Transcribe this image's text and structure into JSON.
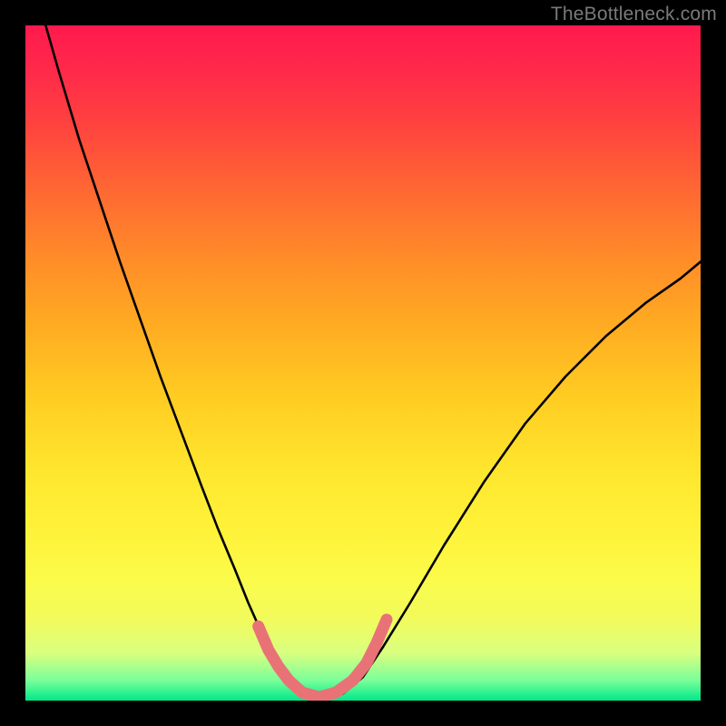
{
  "watermark": "TheBottleneck.com",
  "colors": {
    "background": "#000000",
    "curve": "#000000",
    "highlight": "#e97277",
    "gradient_top": "#ff1a4d",
    "gradient_bottom": "#00e88a"
  },
  "chart_data": {
    "type": "line",
    "title": "",
    "xlabel": "",
    "ylabel": "",
    "xlim": [
      0,
      1
    ],
    "ylim": [
      0,
      1
    ],
    "grid": false,
    "legend": false,
    "annotations": [],
    "series": [
      {
        "name": "left-branch",
        "x": [
          0.03,
          0.05,
          0.08,
          0.11,
          0.14,
          0.17,
          0.2,
          0.23,
          0.26,
          0.285,
          0.31,
          0.33,
          0.35,
          0.37,
          0.385
        ],
        "y": [
          1.0,
          0.93,
          0.83,
          0.74,
          0.65,
          0.565,
          0.48,
          0.4,
          0.32,
          0.255,
          0.195,
          0.145,
          0.1,
          0.06,
          0.035
        ]
      },
      {
        "name": "valley-floor",
        "x": [
          0.385,
          0.41,
          0.44,
          0.47,
          0.5
        ],
        "y": [
          0.035,
          0.01,
          0.0,
          0.01,
          0.035
        ]
      },
      {
        "name": "right-branch",
        "x": [
          0.5,
          0.53,
          0.57,
          0.62,
          0.68,
          0.74,
          0.8,
          0.86,
          0.92,
          0.97,
          1.0
        ],
        "y": [
          0.035,
          0.08,
          0.145,
          0.23,
          0.325,
          0.41,
          0.48,
          0.54,
          0.59,
          0.625,
          0.65
        ]
      }
    ],
    "highlight_region": {
      "name": "optimal-zone",
      "x": [
        0.345,
        0.36,
        0.375,
        0.39,
        0.41,
        0.435,
        0.46,
        0.485,
        0.505,
        0.52,
        0.535
      ],
      "y": [
        0.11,
        0.075,
        0.05,
        0.03,
        0.012,
        0.005,
        0.012,
        0.03,
        0.055,
        0.085,
        0.12
      ]
    }
  }
}
